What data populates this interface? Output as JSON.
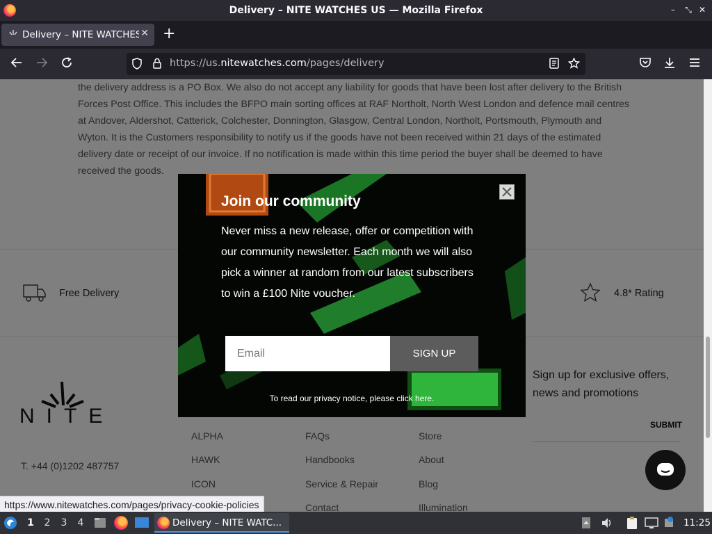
{
  "window": {
    "title": "Delivery – NITE WATCHES US — Mozilla Firefox",
    "controls": {
      "minimize": "–",
      "restore": "⤡",
      "close": "✕"
    }
  },
  "tabs": [
    {
      "label": "Delivery – NITE WATCHES US",
      "active": true
    }
  ],
  "new_tab_label": "+",
  "navbar": {
    "url_prefix": "https://us.",
    "url_domain": "nitewatches.com",
    "url_path": "/pages/delivery"
  },
  "page": {
    "paragraph": "the delivery address is a PO Box. We also do not accept any liability for goods that have been lost after delivery to the British Forces Post Office. This includes the BFPO main sorting offices at RAF Northolt, North West London and defence mail centres at Andover, Aldershot, Catterick, Colchester, Donnington, Glasgow, Central London, Northolt, Portsmouth, Plymouth and Wyton. It is the Customers responsibility to notify us if the goods have not been received within 21 days of the estimated delivery date or receipt of our invoice. If no notification is made within this time period the buyer shall be deemed to have received the goods.",
    "features": [
      {
        "icon": "truck-icon",
        "label": "Free Delivery"
      },
      {
        "icon": "star-icon",
        "label": "4.8* Rating"
      }
    ],
    "brand": "NITE",
    "phone": "T. +44 (0)1202 487757",
    "footer_columns": [
      [
        "ALPHA",
        "HAWK",
        "ICON"
      ],
      [
        "FAQs",
        "Handbooks",
        "Service & Repair",
        "Contact"
      ],
      [
        "Store",
        "About",
        "Blog",
        "Illumination"
      ]
    ],
    "newsletter_text": "Sign up for exclusive offers, news and promotions",
    "submit_label": "SUBMIT"
  },
  "modal": {
    "title": "Join our community",
    "body": "Never miss a new release, offer or competition with our community newsletter. Each month we will also pick a winner at random from our latest subscribers to win a £100 Nite voucher.",
    "email_placeholder": "Email",
    "signup_label": "SIGN UP",
    "privacy_note": "To read our privacy notice, please click here.",
    "close_label": "✕"
  },
  "status_url": "https://www.nitewatches.com/pages/privacy-cookie-policies",
  "taskbar": {
    "workspaces": [
      "1",
      "2",
      "3",
      "4"
    ],
    "active_workspace": "1",
    "task_label": "Delivery – NITE WATC...",
    "clock": "11:25"
  },
  "colors": {
    "titlebar": "#2b2a33",
    "tabstrip": "#1c1b22",
    "modal_button": "#5c5c5c",
    "taskbar": "#2f3136",
    "task_underline": "#5294e2"
  }
}
